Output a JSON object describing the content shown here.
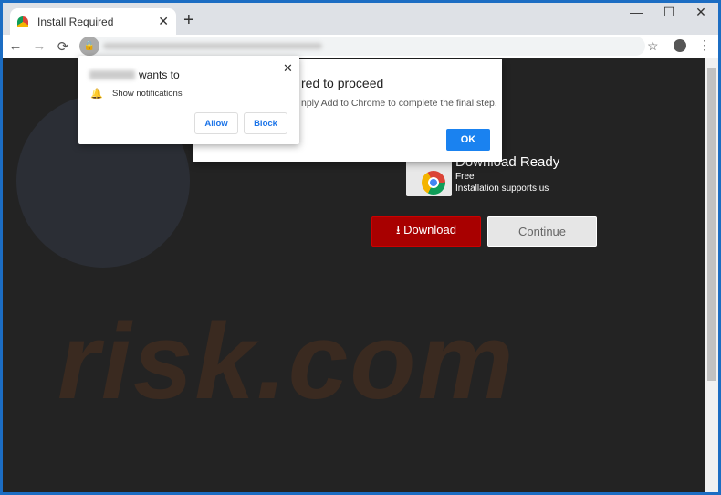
{
  "browser": {
    "tab_title": "Install Required",
    "new_tab": "+",
    "tab_close": "✕",
    "minimize": "—",
    "maximize": "☐",
    "close": "✕",
    "back": "←",
    "forward": "→",
    "reload": "⟳",
    "star": "☆",
    "menu": "⋮"
  },
  "notification": {
    "wants_to": "wants to",
    "permission": "Show notifications",
    "allow": "Allow",
    "block": "Block",
    "close": "✕"
  },
  "alert": {
    "title": "red to proceed",
    "message": "nply Add to Chrome to complete the final step.",
    "ok": "OK"
  },
  "page": {
    "heading": "Download Ready",
    "free": "Free",
    "support": "Installation supports us",
    "download": "Download",
    "continue": "Continue",
    "download_icon": "⭳",
    "watermark": "risk.com"
  },
  "colors": {
    "download": "#a80000",
    "ok": "#1a82f0",
    "window_border": "#1c6dc3"
  }
}
